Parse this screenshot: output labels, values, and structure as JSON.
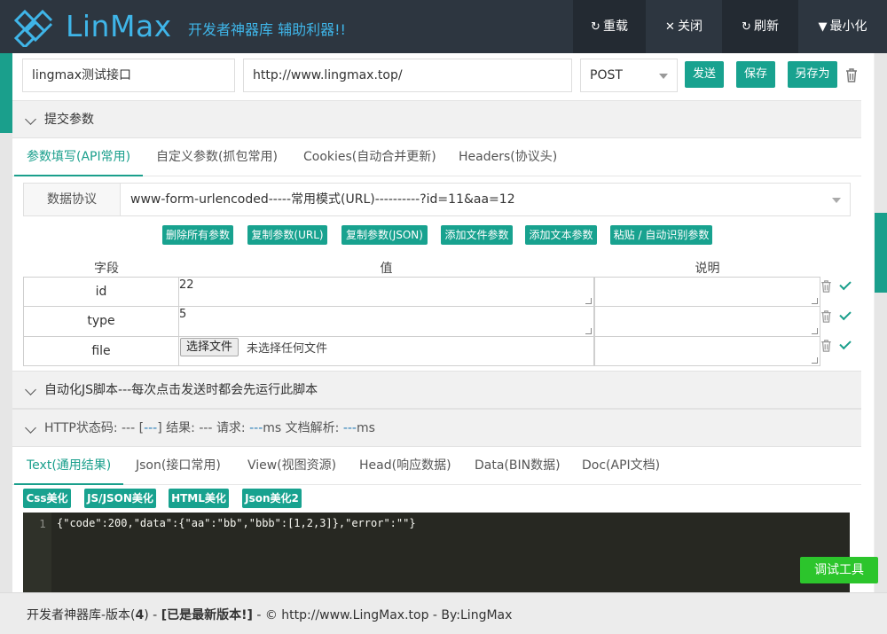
{
  "header": {
    "logo_text": "LinMax",
    "slogan": "开发者神器库 辅助利器!!",
    "buttons": {
      "reload": "重载",
      "close": "关闭",
      "refresh": "刷新",
      "minimize": "最小化"
    }
  },
  "request": {
    "name": "lingmax测试接口",
    "url": "http://www.lingmax.top/",
    "method": "POST",
    "send": "发送",
    "save": "保存",
    "save_as": "另存为"
  },
  "params_section": {
    "title": "提交参数",
    "tabs": [
      "参数填写(API常用)",
      "自定义参数(抓包常用)",
      "Cookies(自动合并更新)",
      "Headers(协议头)"
    ],
    "protocol_label": "数据协议",
    "protocol_value": "www-form-urlencoded-----常用模式(URL)----------?id=11&aa=12",
    "actions": [
      "删除所有参数",
      "复制参数(URL)",
      "复制参数(JSON)",
      "添加文件参数",
      "添加文本参数",
      "粘贴 / 自动识别参数"
    ],
    "columns": {
      "field": "字段",
      "value": "值",
      "desc": "说明"
    },
    "rows": [
      {
        "field": "id",
        "value": "22",
        "desc": ""
      },
      {
        "field": "type",
        "value": "5",
        "desc": ""
      },
      {
        "field": "file",
        "file_button": "选择文件",
        "file_status": "未选择任何文件",
        "desc": ""
      }
    ]
  },
  "script_section": {
    "title": "自动化JS脚本---每次点击发送时都会先运行此脚本"
  },
  "http_section": {
    "status_label": "HTTP状态码:",
    "status_code": "---",
    "status_bracket": "---",
    "result_label": "结果:",
    "result": "---",
    "request_label": "请求:",
    "request_ms": "---",
    "ms1": "ms",
    "parse_label": "文档解析:",
    "parse_ms": "---",
    "ms2": "ms"
  },
  "result_tabs": [
    "Text(通用结果)",
    "Json(接口常用)",
    "View(视图资源)",
    "Head(响应数据)",
    "Data(BIN数据)",
    "Doc(API文档)"
  ],
  "beautify": [
    "Css美化",
    "JS/JSON美化",
    "HTML美化",
    "Json美化2"
  ],
  "code": {
    "line_number": "1",
    "content": "{\"code\":200,\"data\":{\"aa\":\"bb\",\"bbb\":[1,2,3]},\"error\":\"\"}"
  },
  "debug_button": "调试工具",
  "footer": {
    "prefix": "开发者神器库-版本(",
    "version": "4",
    "mid": ") - ",
    "latest": "[已是最新版本!]",
    "suffix": " - © http://www.LingMax.top - By:LingMax"
  },
  "colors": {
    "topbar": "#2d3640",
    "accent": "#1a9f8c",
    "debug": "#2cc52c"
  }
}
